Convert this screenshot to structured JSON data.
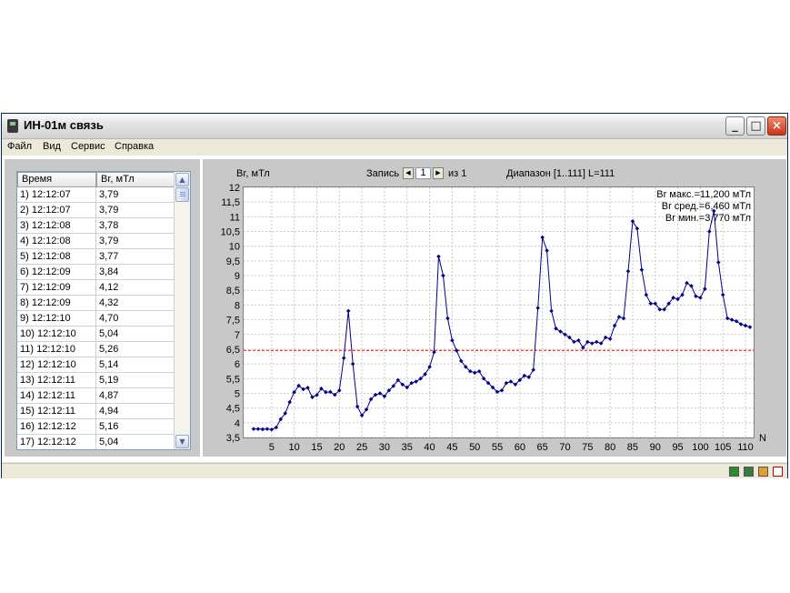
{
  "window": {
    "title": "ИН-01м связь",
    "controls": [
      "_",
      "□",
      "×"
    ]
  },
  "menu": [
    "Файл",
    "Вид",
    "Сервис",
    "Справка"
  ],
  "table": {
    "headers": [
      "Время",
      "Br, мТл"
    ],
    "rows": [
      [
        "1) 12:12:07",
        "3,79"
      ],
      [
        "2) 12:12:07",
        "3,79"
      ],
      [
        "3) 12:12:08",
        "3,78"
      ],
      [
        "4) 12:12:08",
        "3,79"
      ],
      [
        "5) 12:12:08",
        "3,77"
      ],
      [
        "6) 12:12:09",
        "3,84"
      ],
      [
        "7) 12:12:09",
        "4,12"
      ],
      [
        "8) 12:12:09",
        "4,32"
      ],
      [
        "9) 12:12:10",
        "4,70"
      ],
      [
        "10) 12:12:10",
        "5,04"
      ],
      [
        "11) 12:12:10",
        "5,26"
      ],
      [
        "12) 12:12:10",
        "5,14"
      ],
      [
        "13) 12:12:11",
        "5,19"
      ],
      [
        "14) 12:12:11",
        "4,87"
      ],
      [
        "15) 12:12:11",
        "4,94"
      ],
      [
        "16) 12:12:12",
        "5,16"
      ],
      [
        "17) 12:12:12",
        "5,04"
      ]
    ]
  },
  "chart_header": {
    "ylabel": "Br, мТл",
    "record_label": "Запись",
    "record_value": "1",
    "record_of": "из 1",
    "range_text": "Диапазон [1..111]  L=111"
  },
  "stats": [
    "Br макс.=11,200 мТл",
    "Br сред.=6,460 мТл",
    "Br мин.=3,770 мТл"
  ],
  "colors": {
    "series": "#00008b",
    "mean_line": "#ff0000",
    "grid": "#c8c8c8"
  },
  "chart_data": {
    "type": "line",
    "xlabel": "N",
    "ylabel": "Br, мТл",
    "xlim": [
      0,
      111
    ],
    "ylim": [
      3.5,
      12
    ],
    "x_ticks": [
      5,
      10,
      15,
      20,
      25,
      30,
      35,
      40,
      45,
      50,
      55,
      60,
      65,
      70,
      75,
      80,
      85,
      90,
      95,
      100,
      105,
      110
    ],
    "y_ticks": [
      "3,5",
      "4",
      "4,5",
      "5",
      "5,5",
      "6",
      "6,5",
      "7",
      "7,5",
      "8",
      "8,5",
      "9",
      "9,5",
      "10",
      "10,5",
      "11",
      "11,5",
      "12"
    ],
    "mean": 6.46,
    "grid": true,
    "series": [
      {
        "values": [
          3.79,
          3.79,
          3.78,
          3.79,
          3.77,
          3.84,
          4.12,
          4.32,
          4.7,
          5.04,
          5.26,
          5.14,
          5.19,
          4.87,
          4.94,
          5.16,
          5.04,
          5.05,
          4.95,
          5.1,
          6.2,
          7.8,
          6.0,
          4.55,
          4.25,
          4.45,
          4.8,
          4.95,
          5.0,
          4.9,
          5.1,
          5.25,
          5.45,
          5.3,
          5.2,
          5.35,
          5.4,
          5.5,
          5.65,
          5.9,
          6.4,
          9.65,
          9.0,
          7.55,
          6.8,
          6.45,
          6.1,
          5.9,
          5.75,
          5.7,
          5.75,
          5.5,
          5.35,
          5.2,
          5.05,
          5.1,
          5.35,
          5.4,
          5.3,
          5.45,
          5.6,
          5.55,
          5.8,
          7.9,
          10.3,
          9.85,
          7.8,
          7.2,
          7.1,
          7.0,
          6.9,
          6.75,
          6.8,
          6.55,
          6.75,
          6.7,
          6.75,
          6.7,
          6.9,
          6.85,
          7.3,
          7.6,
          7.55,
          9.15,
          10.85,
          10.6,
          9.2,
          8.35,
          8.05,
          8.05,
          7.85,
          7.85,
          8.05,
          8.25,
          8.2,
          8.35,
          8.75,
          8.65,
          8.3,
          8.25,
          8.55,
          10.5,
          11.2,
          9.45,
          8.35,
          7.55,
          7.5,
          7.45,
          7.35,
          7.3,
          7.25
        ]
      }
    ]
  },
  "status_icons": [
    "excel-icon",
    "image-icon",
    "export-icon",
    "pdf-icon"
  ]
}
